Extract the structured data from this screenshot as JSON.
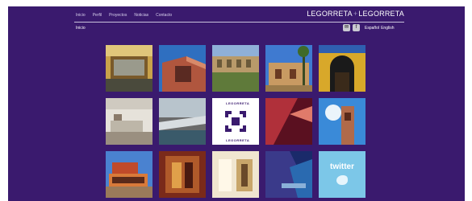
{
  "nav": {
    "items": [
      "Inicio",
      "Perfil",
      "Proyectos",
      "Noticias",
      "Contacto"
    ]
  },
  "brand": {
    "left": "LEGORRETA",
    "sep": "+",
    "right": "LEGORRETA"
  },
  "breadcrumb": "Inicio",
  "languages": {
    "es": "Español",
    "en": "English"
  },
  "social": [
    "email-icon",
    "facebook-icon"
  ],
  "logo_tile": {
    "text": "LEGORRETA"
  },
  "twitter_tile": {
    "text": "twitter"
  },
  "colors": {
    "background": "#3a1a6e",
    "text": "#ffffff"
  }
}
